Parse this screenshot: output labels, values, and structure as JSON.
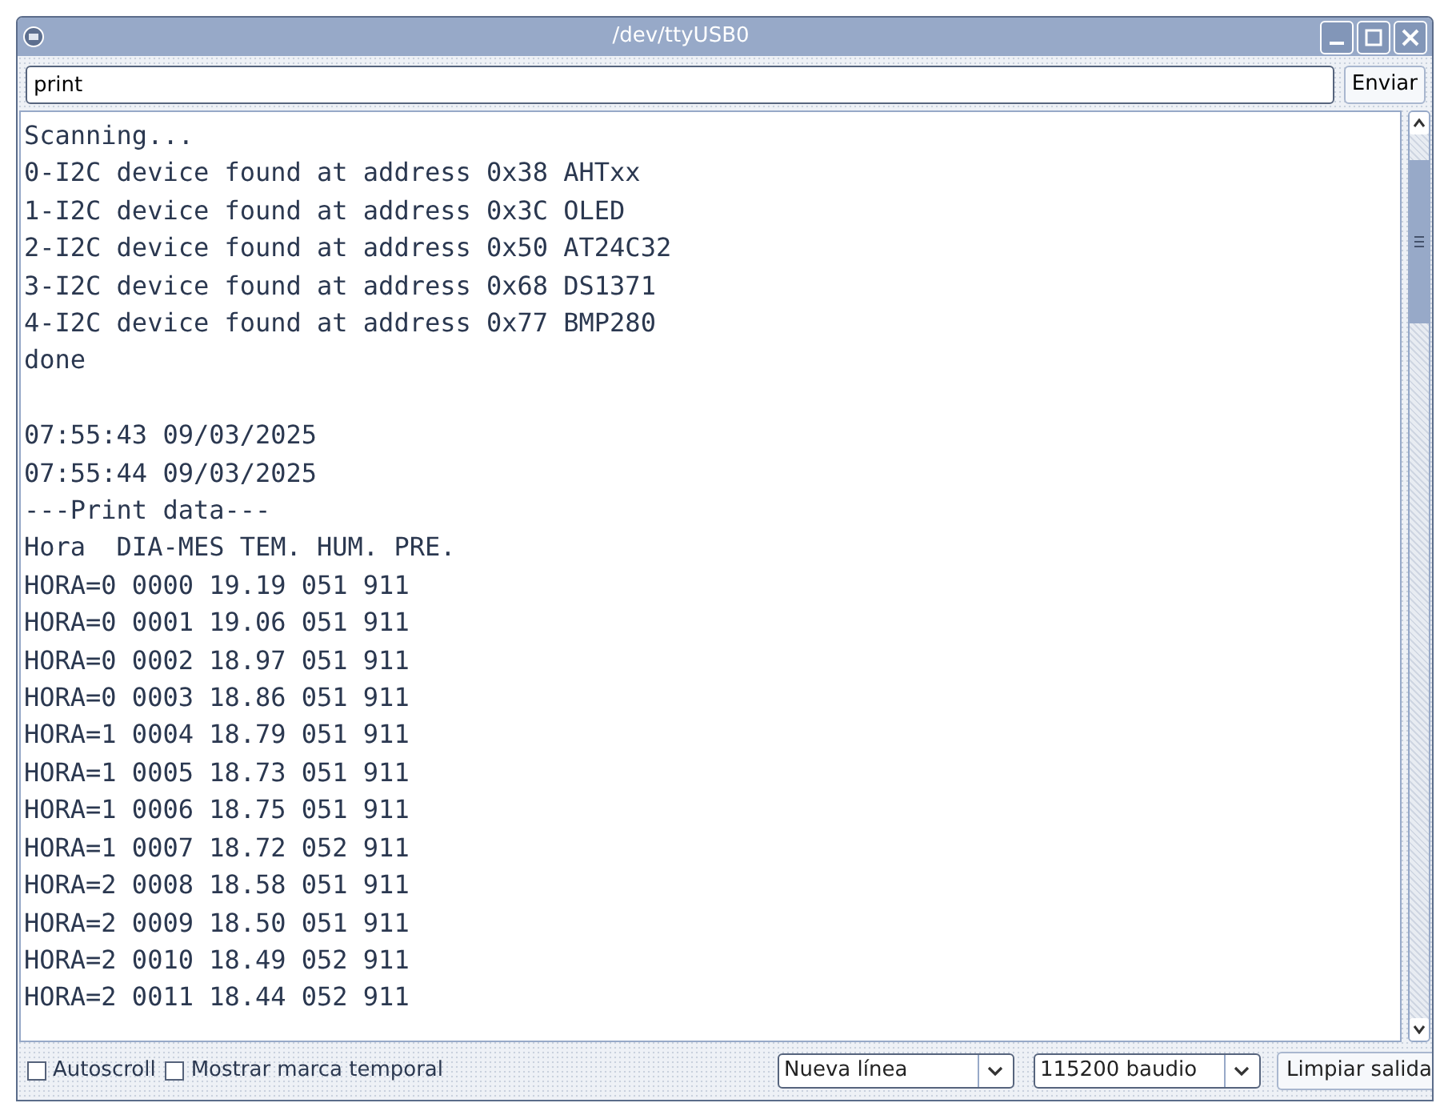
{
  "window": {
    "title": "/dev/ttyUSB0"
  },
  "input": {
    "value": "print"
  },
  "send_button": "Enviar",
  "output": [
    {
      "text": "Scanning..."
    },
    {
      "text": "0-I2C device found at address 0x38 AHTxx"
    },
    {
      "text": "1-I2C device found at address 0x3C OLED"
    },
    {
      "text": "2-I2C device found at address 0x50 AT24C32"
    },
    {
      "text": "3-I2C device found at address 0x68 DS1371"
    },
    {
      "text": "4-I2C device found at address 0x77 BMP280"
    },
    {
      "text": "done"
    },
    {
      "text": "07:55:43 09/03/2025",
      "gap_before": true
    },
    {
      "text": "07:55:44 09/03/2025"
    },
    {
      "text": "---Print data---"
    },
    {
      "text": "Hora  DIA-MES TEM. HUM. PRE."
    },
    {
      "text": "HORA=0 0000 19.19 051 911"
    },
    {
      "text": "HORA=0 0001 19.06 051 911"
    },
    {
      "text": "HORA=0 0002 18.97 051 911"
    },
    {
      "text": "HORA=0 0003 18.86 051 911"
    },
    {
      "text": "HORA=1 0004 18.79 051 911"
    },
    {
      "text": "HORA=1 0005 18.73 051 911"
    },
    {
      "text": "HORA=1 0006 18.75 051 911"
    },
    {
      "text": "HORA=1 0007 18.72 052 911"
    },
    {
      "text": "HORA=2 0008 18.58 051 911"
    },
    {
      "text": "HORA=2 0009 18.50 051 911"
    },
    {
      "text": "HORA=2 0010 18.49 052 911"
    },
    {
      "text": "HORA=2 0011 18.44 052 911"
    }
  ],
  "checkboxes": [
    {
      "label": "Autoscroll",
      "checked": false
    },
    {
      "label": "Mostrar marca temporal",
      "checked": false
    }
  ],
  "line_ending": "Nueva línea",
  "baud_rate": "115200 baudio",
  "clear_button": "Limpiar salida"
}
